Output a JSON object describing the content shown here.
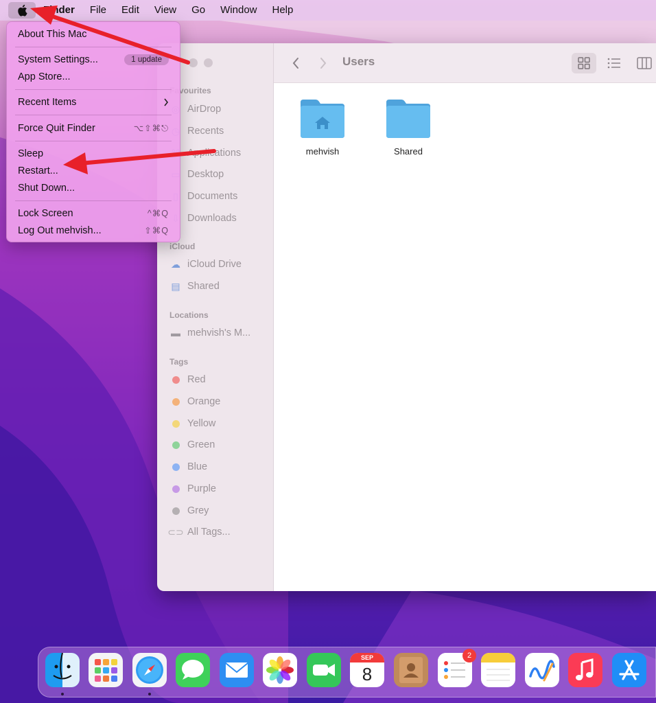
{
  "menubar": {
    "items": [
      "Finder",
      "File",
      "Edit",
      "View",
      "Go",
      "Window",
      "Help"
    ]
  },
  "apple_menu": {
    "about": "About This Mac",
    "system_settings": "System Settings...",
    "update_badge": "1 update",
    "app_store": "App Store...",
    "recent_items": "Recent Items",
    "force_quit": "Force Quit Finder",
    "force_quit_shortcut": "⌥⇧⌘⎋",
    "sleep": "Sleep",
    "restart": "Restart...",
    "shut_down": "Shut Down...",
    "lock_screen": "Lock Screen",
    "lock_screen_shortcut": "^⌘Q",
    "log_out": "Log Out mehvish...",
    "log_out_shortcut": "⇧⌘Q"
  },
  "finder": {
    "title": "Users",
    "sidebar": {
      "favourites_heading": "Favourites",
      "favourites": [
        "AirDrop",
        "Recents",
        "Applications",
        "Desktop",
        "Documents",
        "Downloads"
      ],
      "icloud_heading": "iCloud",
      "icloud": [
        "iCloud Drive",
        "Shared"
      ],
      "locations_heading": "Locations",
      "locations": [
        "mehvish's M..."
      ],
      "tags_heading": "Tags",
      "tags": [
        {
          "label": "Red",
          "color": "#f08c8c"
        },
        {
          "label": "Orange",
          "color": "#f4b27a"
        },
        {
          "label": "Yellow",
          "color": "#f3d77a"
        },
        {
          "label": "Green",
          "color": "#8fd39a"
        },
        {
          "label": "Blue",
          "color": "#8db3f3"
        },
        {
          "label": "Purple",
          "color": "#c79ae6"
        },
        {
          "label": "Grey",
          "color": "#b5b0b3"
        }
      ],
      "all_tags": "All Tags..."
    },
    "folders": [
      "mehvish",
      "Shared"
    ]
  },
  "dock": {
    "apps": [
      "Finder",
      "Launchpad",
      "Safari",
      "Messages",
      "Mail",
      "Photos",
      "FaceTime",
      "Calendar",
      "Contacts",
      "Reminders",
      "Notes",
      "Freeform",
      "Music",
      "App Store"
    ],
    "calendar_month": "SEP",
    "calendar_day": "8",
    "reminders_badge": "2"
  },
  "colors": {
    "annotation_arrow": "#e8202a",
    "menu_bg": "#efa0ec",
    "folder_blue": "#5ab6ea"
  }
}
